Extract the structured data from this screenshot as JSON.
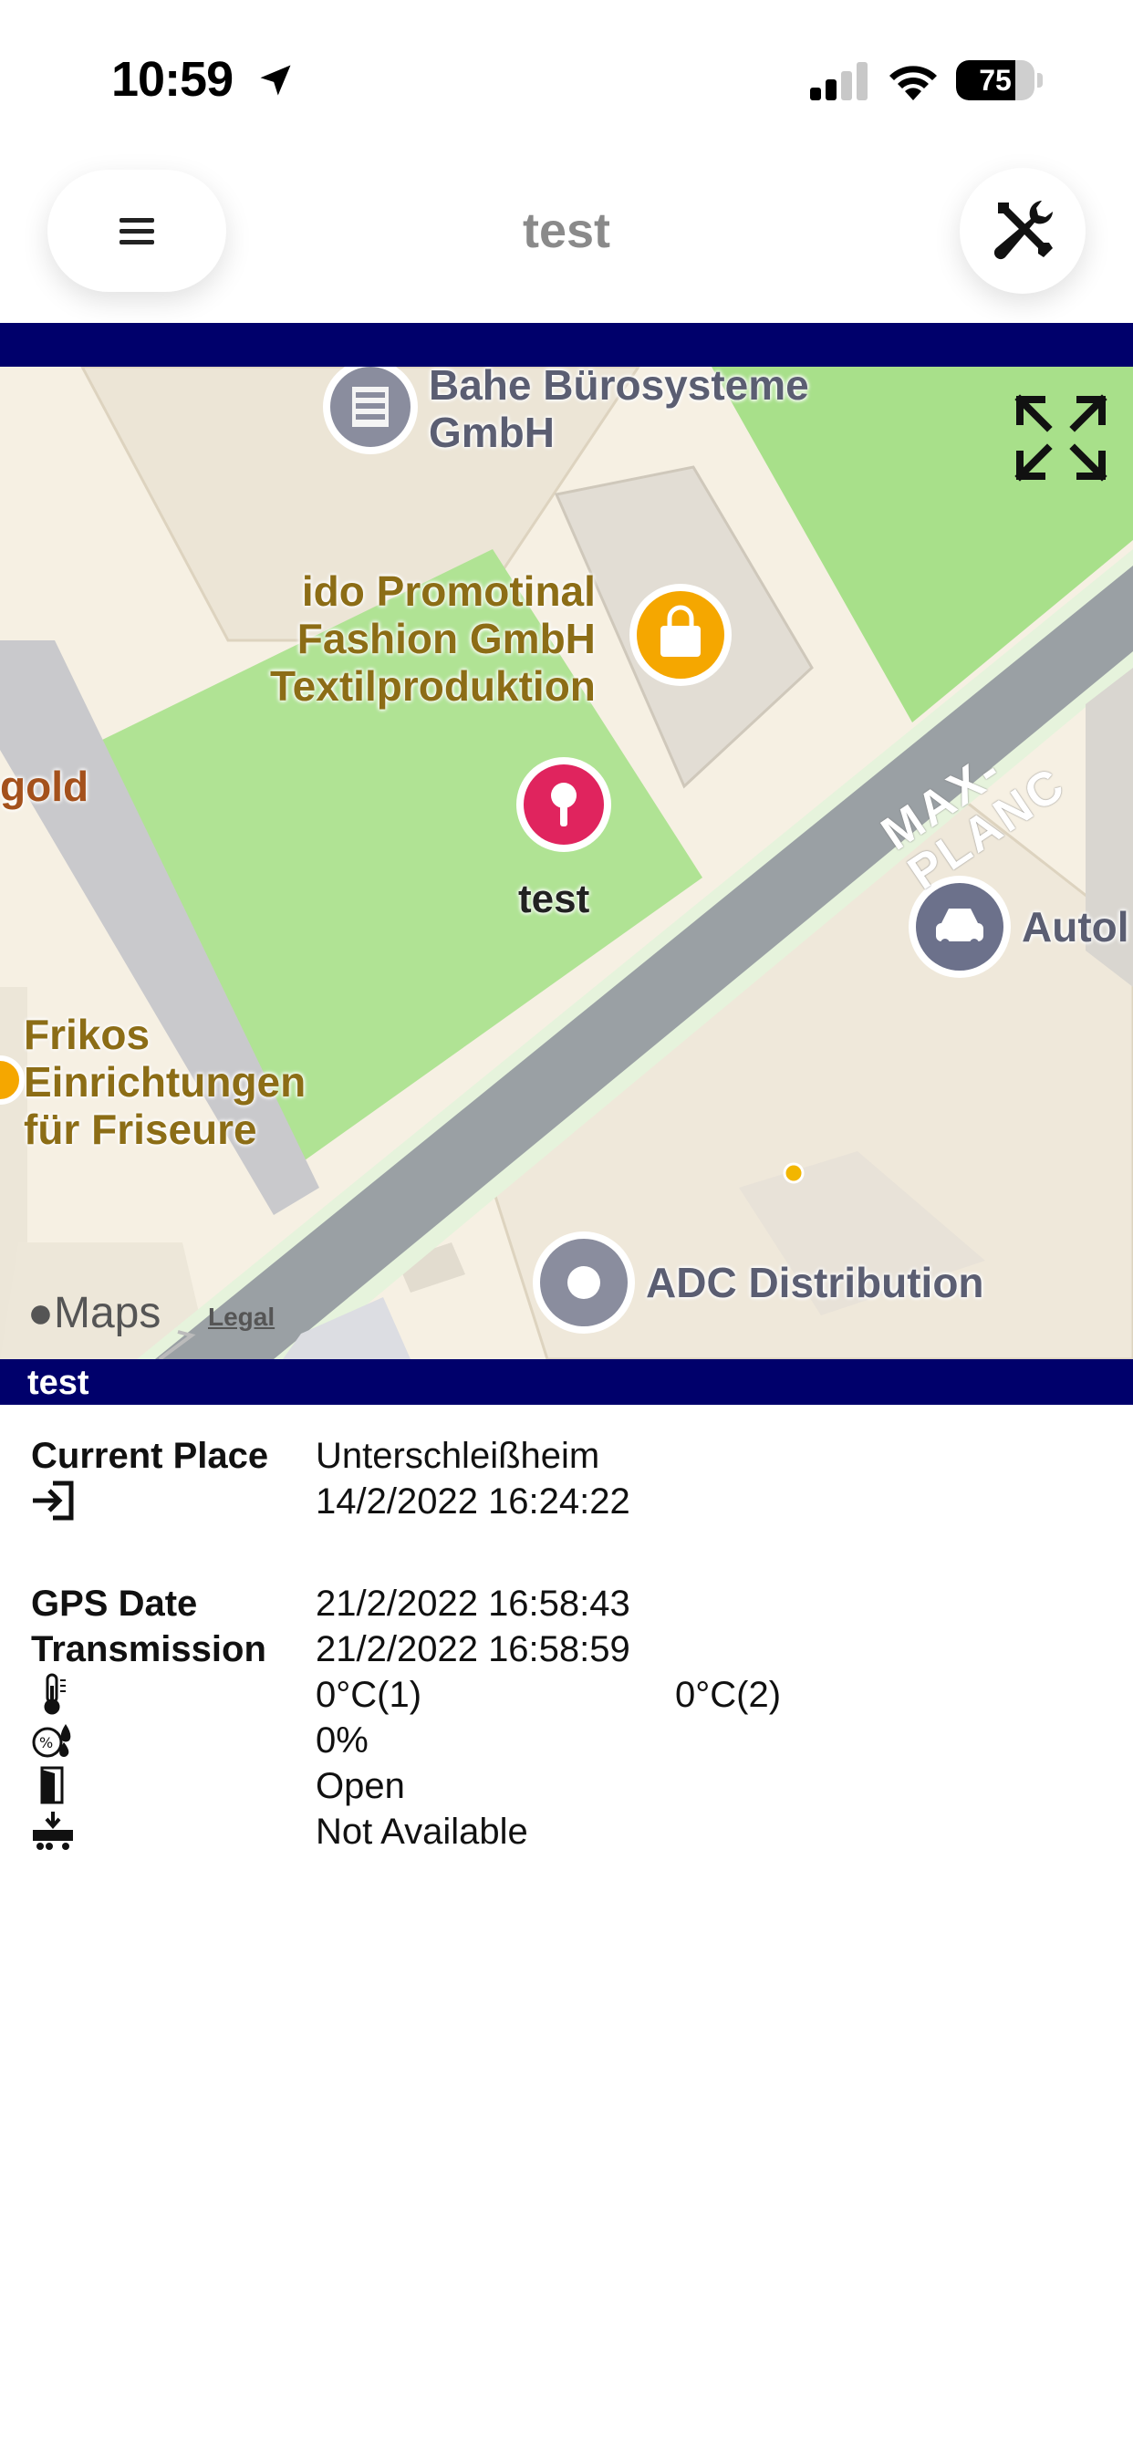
{
  "status_bar": {
    "time": "10:59",
    "battery": "75",
    "battery_level": 0.75
  },
  "nav": {
    "title": "test",
    "menu_icon": "hamburger-icon",
    "settings_icon": "tools-icon"
  },
  "map": {
    "pois": {
      "bahe": "Bahe Bürosysteme\nGmbH",
      "ido": "ido Promotinal\nFashion GmbH\nTextilproduktion",
      "gold": "gold",
      "frikos": "Frikos\nEinrichtungen\nfür Friseure",
      "autol": "Autol",
      "adc": "ADC Distribution"
    },
    "street": "MAX-PLANC",
    "pin_label": "test",
    "attribution": "Maps",
    "legal": "Legal"
  },
  "info": {
    "header": "test",
    "current_place_label": "Current Place",
    "current_place_value": "Unterschleißheim",
    "entered_time": "14/2/2022 16:24:22",
    "gps_date_label": "GPS Date",
    "gps_date_value": "21/2/2022 16:58:43",
    "transmission_label": "Transmission",
    "transmission_value": "21/2/2022 16:58:59",
    "temp1": "0°C(1)",
    "temp2": "0°C(2)",
    "humidity": "0%",
    "door": "Open",
    "cargo": "Not Available"
  },
  "colors": {
    "navy": "#00006b",
    "pin": "#e0245e",
    "park": "#a8e08a"
  }
}
